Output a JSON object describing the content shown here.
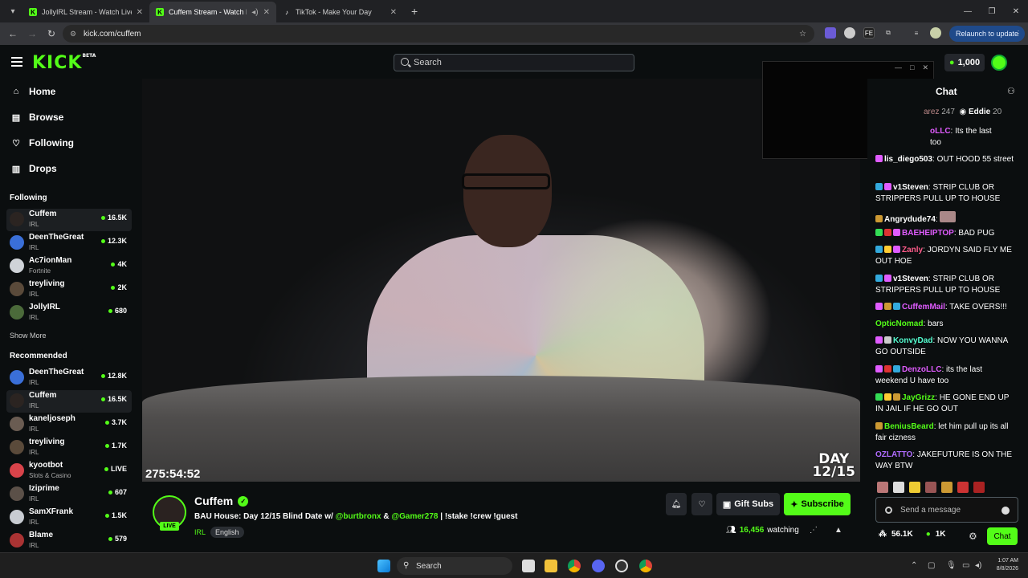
{
  "browser": {
    "tabs": [
      {
        "title": "JollyIRL Stream - Watch Live on",
        "active": false
      },
      {
        "title": "Cuffem Stream - Watch Live",
        "active": true
      },
      {
        "title": "TikTok - Make Your Day",
        "active": false
      }
    ],
    "url": "kick.com/cuffem",
    "relaunch_label": "Relaunch to update"
  },
  "header": {
    "logo": "KICK",
    "logo_badge": "BETA",
    "search_placeholder": "Search",
    "kicks_balance": "1,000"
  },
  "sidebar": {
    "nav": [
      {
        "label": "Home",
        "icon": "home-icon"
      },
      {
        "label": "Browse",
        "icon": "browse-icon"
      },
      {
        "label": "Following",
        "icon": "heart-icon"
      },
      {
        "label": "Drops",
        "icon": "drops-icon"
      }
    ],
    "following_title": "Following",
    "following": [
      {
        "name": "Cuffem",
        "category": "IRL",
        "viewers": "16.5K"
      },
      {
        "name": "DeenTheGreat",
        "category": "IRL",
        "viewers": "12.3K"
      },
      {
        "name": "Ac7ionMan",
        "category": "Fortnite",
        "viewers": "4K"
      },
      {
        "name": "treyliving",
        "category": "IRL",
        "viewers": "2K"
      },
      {
        "name": "JollyIRL",
        "category": "IRL",
        "viewers": "680"
      }
    ],
    "show_more": "Show More",
    "recommended_title": "Recommended",
    "recommended": [
      {
        "name": "DeenTheGreat",
        "category": "IRL",
        "viewers": "12.8K"
      },
      {
        "name": "Cuffem",
        "category": "IRL",
        "viewers": "16.5K"
      },
      {
        "name": "kaneljoseph",
        "category": "IRL",
        "viewers": "3.7K"
      },
      {
        "name": "treyliving",
        "category": "IRL",
        "viewers": "1.7K"
      },
      {
        "name": "kyootbot",
        "category": "Slots & Casino",
        "viewers": "LIVE"
      },
      {
        "name": "Iziprime",
        "category": "IRL",
        "viewers": "607"
      },
      {
        "name": "SamXFrank",
        "category": "IRL",
        "viewers": "1.5K"
      },
      {
        "name": "Blame",
        "category": "IRL",
        "viewers": "579"
      }
    ]
  },
  "video": {
    "timer": "275:54:52",
    "day_label": "DAY",
    "day_value": "12/15"
  },
  "stream": {
    "name": "Cuffem",
    "title_prefix": "BAU House: Day 12/15 Blind Date w/ ",
    "mention1": "@burtbronx",
    "amp": " & ",
    "mention2": "@Gamer278",
    "title_suffix": " | !stake !crew !guest",
    "category": "IRL",
    "language": "English",
    "live_label": "LIVE",
    "gift_subs": "Gift Subs",
    "subscribe": "Subscribe",
    "watching_count": "16,456",
    "watching_label": "watching"
  },
  "chat": {
    "title": "Chat",
    "pinned": [
      {
        "name": "arez",
        "count": "247"
      },
      {
        "name": "Eddie",
        "count": "20"
      }
    ],
    "messages": [
      {
        "user": "oLLC",
        "color": "#e05cff",
        "text": ": Its the last",
        "cont": "too"
      },
      {
        "user": "lis_diego503",
        "color": "#ffffff",
        "text": ": OUT HOOD 55 street"
      },
      {
        "user": "v1Steven",
        "color": "#ffffff",
        "text": ": STRIP CLUB OR STRIPPERS PULL UP TO HOUSE"
      },
      {
        "user": "Angrydude74",
        "color": "#ffffff",
        "text": ":"
      },
      {
        "user": "BAEHEIPTOP",
        "color": "#e05cff",
        "text": ": BAD PUG"
      },
      {
        "user": "Zanly",
        "color": "#ff5c8a",
        "text": ": JORDYN SAID FLY ME OUT HOE"
      },
      {
        "user": "v1Steven",
        "color": "#ffffff",
        "text": ": STRIP CLUB OR STRIPPERS PULL UP TO HOUSE"
      },
      {
        "user": "CuffemMail",
        "color": "#e05cff",
        "text": ": TAKE OVERS!!!"
      },
      {
        "user": "OpticNomad",
        "color": "#53fc18",
        "text": ": bars"
      },
      {
        "user": "KonvyDad",
        "color": "#53fccf",
        "text": ": NOW YOU WANNA GO OUTSIDE"
      },
      {
        "user": "DenzoLLC",
        "color": "#e05cff",
        "text": ": its the last weekend U have too"
      },
      {
        "user": "JayGrizz",
        "color": "#53fc18",
        "text": ": HE GONE END UP IN JAIL IF HE GO OUT"
      },
      {
        "user": "BeniusBeard",
        "color": "#53fc18",
        "text": ": let him pull up its all fair cizness"
      },
      {
        "user": "OZLATTO",
        "color": "#b06cff",
        "text": ": JAKEFUTURE IS ON THE WAY BTW"
      }
    ],
    "input_placeholder": "Send a message",
    "followers": "56.1K",
    "kicks": "1K",
    "chat_button": "Chat"
  },
  "taskbar": {
    "search": "Search",
    "time": "1:07 AM",
    "date": "8/8/2026"
  },
  "colors": {
    "accent": "#53fc18",
    "bg": "#0b0e0f"
  }
}
